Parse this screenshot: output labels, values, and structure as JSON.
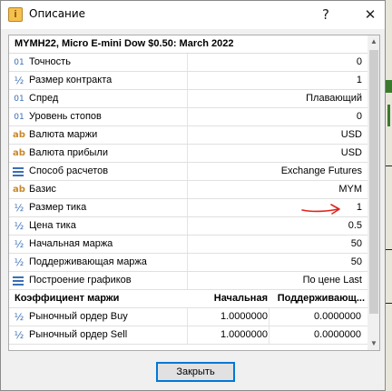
{
  "window": {
    "title": "Описание",
    "app_icon": "info-book-icon",
    "help_symbol": "?",
    "close_symbol": "✕"
  },
  "spec": {
    "header": "MYMH22, Micro E-mini Dow $0.50: March 2022",
    "rows": [
      {
        "icon": "01",
        "label": "Точность",
        "value": "0"
      },
      {
        "icon": "½",
        "label": "Размер контракта",
        "value": "1"
      },
      {
        "icon": "01",
        "label": "Спред",
        "value": "Плавающий"
      },
      {
        "icon": "01",
        "label": "Уровень стопов",
        "value": "0"
      },
      {
        "icon": "ab",
        "label": "Валюта маржи",
        "value": "USD"
      },
      {
        "icon": "ab",
        "label": "Валюта прибыли",
        "value": "USD"
      },
      {
        "icon": "lines",
        "label": "Способ расчетов",
        "value": "Exchange Futures"
      },
      {
        "icon": "ab",
        "label": "Базис",
        "value": "MYM"
      },
      {
        "icon": "½",
        "label": "Размер тика",
        "value": "1"
      },
      {
        "icon": "½",
        "label": "Цена тика",
        "value": "0.5"
      },
      {
        "icon": "½",
        "label": "Начальная маржа",
        "value": "50"
      },
      {
        "icon": "½",
        "label": "Поддерживающая маржа",
        "value": "50"
      },
      {
        "icon": "lines",
        "label": "Построение графиков",
        "value": "По цене Last"
      }
    ],
    "margin_table": {
      "header": "Коэффициент маржи",
      "col1": "Начальная",
      "col2": "Поддерживающ...",
      "rows": [
        {
          "icon": "½",
          "label": "Рыночный ордер Buy",
          "v1": "1.0000000",
          "v2": "0.0000000"
        },
        {
          "icon": "½",
          "label": "Рыночный ордер Sell",
          "v1": "1.0000000",
          "v2": "0.0000000"
        }
      ]
    }
  },
  "buttons": {
    "close_label": "Закрыть"
  },
  "annotation": {
    "arrow_color": "#e0241c"
  }
}
